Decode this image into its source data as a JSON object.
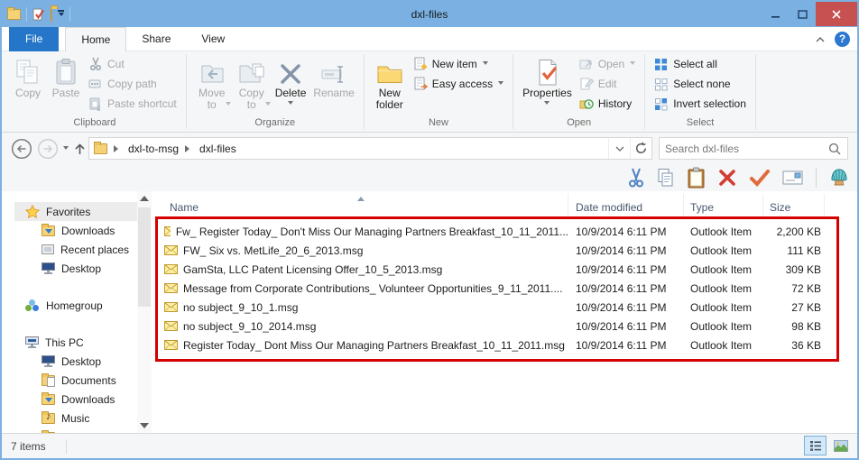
{
  "window": {
    "title": "dxl-files"
  },
  "tabs": {
    "file": "File",
    "home": "Home",
    "share": "Share",
    "view": "View"
  },
  "ribbon": {
    "clipboard": {
      "copy": "Copy",
      "paste": "Paste",
      "cut": "Cut",
      "copy_path": "Copy path",
      "paste_shortcut": "Paste shortcut",
      "label": "Clipboard"
    },
    "organize": {
      "move_to": "Move to",
      "copy_to": "Copy to",
      "delete": "Delete",
      "rename": "Rename",
      "label": "Organize"
    },
    "new_group": {
      "new_folder": "New folder",
      "new_item": "New item",
      "easy_access": "Easy access",
      "label": "New"
    },
    "open_group": {
      "properties": "Properties",
      "open": "Open",
      "edit": "Edit",
      "history": "History",
      "label": "Open"
    },
    "select_group": {
      "select_all": "Select all",
      "select_none": "Select none",
      "invert": "Invert selection",
      "label": "Select"
    }
  },
  "address": {
    "crumb1": "dxl-to-msg",
    "crumb2": "dxl-files",
    "search_placeholder": "Search dxl-files"
  },
  "list": {
    "columns": {
      "name": "Name",
      "date": "Date modified",
      "type": "Type",
      "size": "Size"
    },
    "files": [
      {
        "name": "Fw_ Register Today_ Don't Miss Our Managing Partners Breakfast_10_11_2011...",
        "date": "10/9/2014 6:11 PM",
        "type": "Outlook Item",
        "size": "2,200 KB"
      },
      {
        "name": "FW_ Six vs. MetLife_20_6_2013.msg",
        "date": "10/9/2014 6:11 PM",
        "type": "Outlook Item",
        "size": "111 KB"
      },
      {
        "name": "GamSta, LLC Patent Licensing Offer_10_5_2013.msg",
        "date": "10/9/2014 6:11 PM",
        "type": "Outlook Item",
        "size": "309 KB"
      },
      {
        "name": "Message from Corporate Contributions_ Volunteer Opportunities_9_11_2011....",
        "date": "10/9/2014 6:11 PM",
        "type": "Outlook Item",
        "size": "72 KB"
      },
      {
        "name": "no subject_9_10_1.msg",
        "date": "10/9/2014 6:11 PM",
        "type": "Outlook Item",
        "size": "27 KB"
      },
      {
        "name": "no subject_9_10_2014.msg",
        "date": "10/9/2014 6:11 PM",
        "type": "Outlook Item",
        "size": "98 KB"
      },
      {
        "name": "Register Today_ Dont Miss Our Managing Partners Breakfast_10_11_2011.msg",
        "date": "10/9/2014 6:11 PM",
        "type": "Outlook Item",
        "size": "36 KB"
      }
    ]
  },
  "sidebar": {
    "favorites": "Favorites",
    "fav_downloads": "Downloads",
    "fav_recent": "Recent places",
    "fav_desktop": "Desktop",
    "homegroup": "Homegroup",
    "this_pc": "This PC",
    "pc_desktop": "Desktop",
    "pc_documents": "Documents",
    "pc_downloads": "Downloads",
    "pc_music": "Music"
  },
  "status": {
    "items": "7 items"
  },
  "colors": {
    "titlebar_blue": "#7ab1e2",
    "file_tab_blue": "#2576c9",
    "close_red": "#c75050",
    "annotation_red": "#d50000",
    "ribbon_bg": "#f5f6f7"
  }
}
